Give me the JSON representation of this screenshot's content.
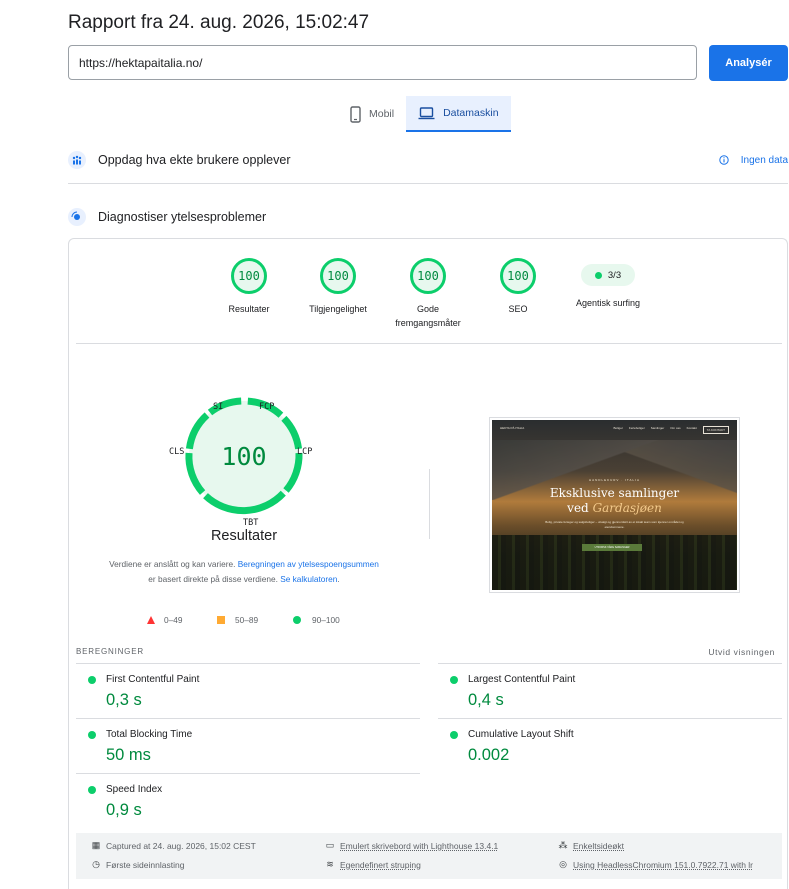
{
  "header": {
    "title": "Rapport fra 24. aug. 2026, 15:02:47"
  },
  "search": {
    "url_value": "https://hektapaitalia.no/",
    "analyze_label": "Analysér"
  },
  "device_tabs": [
    {
      "label": "Mobil",
      "icon": "phone-icon",
      "active": false
    },
    {
      "label": "Datamaskin",
      "icon": "laptop-icon",
      "active": true
    }
  ],
  "sections": {
    "field_data": {
      "label": "Oppdag hva ekte brukere opplever",
      "no_data_label": "Ingen data"
    },
    "diagnostics": {
      "label": "Diagnostiser ytelsesproblemer"
    }
  },
  "categories": [
    {
      "score": "100",
      "label": "Resultater"
    },
    {
      "score": "100",
      "label": "Tilgjengelighet"
    },
    {
      "score": "100",
      "label": "Gode fremgangsmåter"
    },
    {
      "score": "100",
      "label": "SEO"
    },
    {
      "score": "3/3",
      "label": "Agentisk surfing"
    }
  ],
  "performance": {
    "score": "100",
    "label": "Resultater",
    "metric_tags": {
      "si": "SI",
      "fcp": "FCP",
      "lcp": "LCP",
      "tbt": "TBT",
      "cls": "CLS"
    },
    "explain_prefix": "Verdiene er anslått og kan variere. ",
    "explain_link1": "Beregningen av ytelsespoengsummen",
    "explain_middle": " er basert direkte på disse verdiene. ",
    "explain_link2": "Se kalkulatoren",
    "explain_suffix": ".",
    "legend": [
      {
        "range": "0–49",
        "color": "#ff3333"
      },
      {
        "range": "50–89",
        "color": "#ffaa33"
      },
      {
        "range": "90–100",
        "color": "#0cce6b"
      }
    ]
  },
  "screenshot": {
    "kicker": "HANDLEKURV · ITALIA",
    "headline_line1": "Eksklusive samlinger",
    "headline_prefix": "ved ",
    "headline_italic": "Gardasjøen",
    "subtitle": "Bolig, private ferieger og salgsboliger – utvalgt og gjennomført av et lokalt team som kjenner området og eiendommene.",
    "cta": "UTFORSK VÅRE SAMLINGER",
    "nav_brand": "HEKTA PÅ ITALIA",
    "nav_links": [
      "Boliger",
      "Ferieboliger",
      "Samlinger",
      "Om oss",
      "Kontakt"
    ],
    "nav_button": "TA KONTAKT"
  },
  "metrics": {
    "heading": "BEREGNINGER",
    "expand_label": "Utvid visningen",
    "items": [
      {
        "name": "First Contentful Paint",
        "value": "0,3 s"
      },
      {
        "name": "Largest Contentful Paint",
        "value": "0,4 s"
      },
      {
        "name": "Total Blocking Time",
        "value": "50 ms"
      },
      {
        "name": "Cumulative Layout Shift",
        "value": "0.002"
      },
      {
        "name": "Speed Index",
        "value": "0,9 s"
      }
    ]
  },
  "footer": {
    "captured": "Captured at 24. aug. 2026, 15:02 CEST",
    "emulated": "Emulert skrivebord with Lighthouse 13.4.1",
    "single_session": "Enkeltsideøkt",
    "first_load": "Første sideinnlasting",
    "throttling": "Egendefinert struping",
    "browser": "Using HeadlessChromium 151.0.7922.71 with lr"
  },
  "colors": {
    "accent": "#1a73e8",
    "pass": "#0cce6b",
    "pass_text": "#008a3e"
  }
}
